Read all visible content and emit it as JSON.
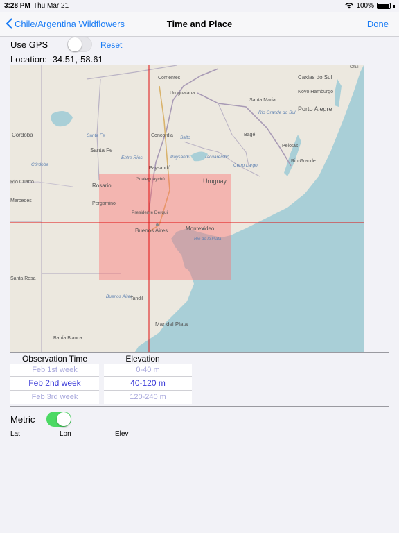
{
  "status_bar": {
    "time": "3:28 PM",
    "date": "Thu Mar 21",
    "battery": "100%"
  },
  "nav": {
    "back_label": "Chile/Argentina Wildflowers",
    "title": "Time and Place",
    "done_label": "Done"
  },
  "gps": {
    "label": "Use GPS",
    "enabled": false,
    "reset_label": "Reset"
  },
  "location_text": "Location: -34.51,-58.61",
  "map": {
    "labels": {
      "corrientes": "Corrientes",
      "uruguaiana": "Uruguaiana",
      "santa_maria": "Santa Maria",
      "caxias_do_sul": "Caxias do Sul",
      "novo_hamburgo": "Novo Hamburgo",
      "porto_alegre": "Porto Alegre",
      "rio_grande_do_sul": "Rio Grande do Sul",
      "cordoba": "Córdoba",
      "cordoba_prov": "Córdoba",
      "santa_fe_prov": "Santa Fe",
      "santa_fe": "Santa Fe",
      "concordia": "Concordia",
      "salto": "Salto",
      "bage": "Bagé",
      "entre_rios": "Entre Ríos",
      "paysandu_dept": "Paysandú",
      "tacuarembo": "Tacuarembó",
      "pelotas": "Pelotas",
      "cerro_largo": "Cerro Largo",
      "rio_grande": "Rio Grande",
      "paysandu": "Paysandú",
      "rio_cuarto": "Río Cuarto",
      "rosario": "Rosario",
      "gualeguaychu": "Gualeguaychú",
      "uruguay": "Uruguay",
      "mercedes": "Mercedes",
      "pergamino": "Pergamino",
      "presidente_derqui": "Presidente Derqui",
      "buenos_aires": "Buenos Aires",
      "montevideo": "Montevideo",
      "rio_de_la_plata": "Río de la Plata",
      "santa_rosa": "Santa Rosa",
      "buenos_aires_prov": "Buenos Aires",
      "tandil": "Tandil",
      "mar_del_plata": "Mar del Plata",
      "bahia_blanca": "Bahía Blanca",
      "chuy": "Chuí"
    }
  },
  "observation_time": {
    "header": "Observation Time",
    "options": [
      "Feb 1st week",
      "Feb 2nd week",
      "Feb 3rd week"
    ],
    "selected": "Feb 2nd week"
  },
  "elevation": {
    "header": "Elevation",
    "options": [
      "0-40 m",
      "40-120 m",
      "120-240 m"
    ],
    "selected": "40-120 m"
  },
  "metric": {
    "label": "Metric",
    "enabled": true
  },
  "coords_header": {
    "lat": "Lat",
    "lon": "Lon",
    "elev": "Elev"
  },
  "colors": {
    "accent": "#1a7cf5",
    "picker_text": "#3a3ad8",
    "toggle_on": "#4cd964",
    "water": "#a9cfd7",
    "crosshair": "#e01010",
    "selection_overlay": "#ff6a6a"
  }
}
